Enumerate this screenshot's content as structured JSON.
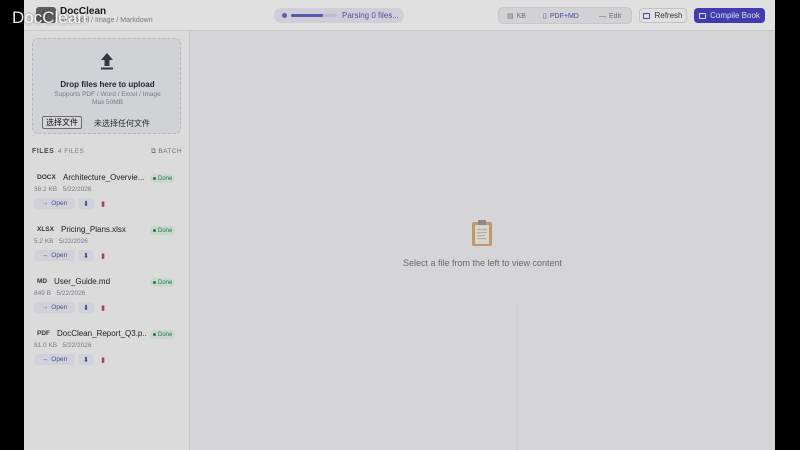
{
  "watermark": "DocClean",
  "header": {
    "title": "DocClean",
    "subtitle": "rd / Excel / Image / Markdown",
    "progress_text": "Parsing 0 files...",
    "progress": 0.7,
    "modes": [
      {
        "icon": "kb-icon",
        "label": "KB"
      },
      {
        "icon": "pdf-md-icon",
        "label": "PDF+MD"
      },
      {
        "icon": "edit-icon",
        "label": "Edit"
      }
    ],
    "active_mode": "PDF+MD",
    "refresh_label": "Refresh",
    "compile_label": "Compile Book"
  },
  "upload": {
    "title": "Drop files here to upload",
    "hint": "Supports PDF / Word / Excel / Image",
    "max": "Max 50MB",
    "choose_button": "选择文件",
    "no_file": "未选择任何文件"
  },
  "files": {
    "label": "FILES",
    "count": "4 FILES",
    "batch": "BATCH",
    "items": [
      {
        "type": "DOCX",
        "name": "Architecture_Overvie...",
        "size": "38.2 KB",
        "date": "5/22/2026",
        "status": "Done"
      },
      {
        "type": "XLSX",
        "name": "Pricing_Plans.xlsx",
        "size": "5.2 KB",
        "date": "5/22/2026",
        "status": "Done"
      },
      {
        "type": "MD",
        "name": "User_Guide.md",
        "size": "849 B",
        "date": "5/22/2026",
        "status": "Done"
      },
      {
        "type": "PDF",
        "name": "DocClean_Report_Q3.p...",
        "size": "81.0 KB",
        "date": "5/22/2026",
        "status": "Done"
      }
    ],
    "open_label": "Open"
  },
  "main": {
    "empty_text": "Select a file from the left to view content"
  },
  "colors": {
    "accent": "#4b44c9",
    "done": "#2e8b57",
    "delete": "#c0505a"
  }
}
